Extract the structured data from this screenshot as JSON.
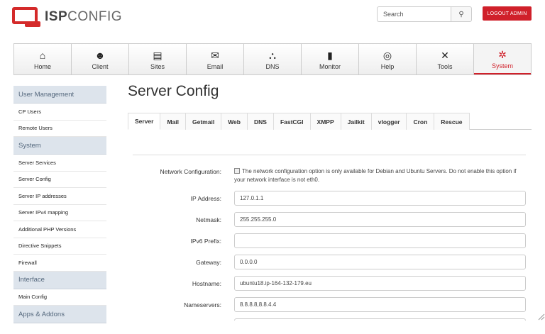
{
  "header": {
    "logo_isp": "ISP",
    "logo_config": "CONFIG",
    "search_placeholder": "Search",
    "search_icon": "search-icon",
    "logout_label": "LOGOUT ADMIN"
  },
  "nav": [
    {
      "label": "Home",
      "icon": "home-icon",
      "glyph": "⌂"
    },
    {
      "label": "Client",
      "icon": "users-icon",
      "glyph": "👥"
    },
    {
      "label": "Sites",
      "icon": "sites-icon",
      "glyph": "▤"
    },
    {
      "label": "Email",
      "icon": "email-icon",
      "glyph": "✉"
    },
    {
      "label": "DNS",
      "icon": "dns-icon",
      "glyph": "⛬"
    },
    {
      "label": "Monitor",
      "icon": "monitor-icon",
      "glyph": "▮"
    },
    {
      "label": "Help",
      "icon": "help-icon",
      "glyph": "◎"
    },
    {
      "label": "Tools",
      "icon": "tools-icon",
      "glyph": "✕"
    },
    {
      "label": "System",
      "icon": "gear-icon",
      "glyph": "✲"
    }
  ],
  "sidebar": {
    "user_management": "User Management",
    "cp_users": "CP Users",
    "remote_users": "Remote Users",
    "system": "System",
    "server_services": "Server Services",
    "server_config": "Server Config",
    "server_ip": "Server IP addresses",
    "server_ipv4": "Server IPv4 mapping",
    "additional_php": "Additional PHP Versions",
    "directive_snippets": "Directive Snippets",
    "firewall": "Firewall",
    "interface": "Interface",
    "main_config": "Main Config",
    "apps_addons": "Apps & Addons"
  },
  "main": {
    "title": "Server Config",
    "tabs": [
      "Server",
      "Mail",
      "Getmail",
      "Web",
      "DNS",
      "FastCGI",
      "XMPP",
      "Jailkit",
      "vlogger",
      "Cron",
      "Rescue"
    ],
    "active_tab": "Server"
  },
  "form": {
    "network_label": "Network Configuration:",
    "network_text": "The network configuration option is only available for Debian and Ubuntu Servers. Do not enable this option if your network interface is not eth0.",
    "ip_label": "IP Address:",
    "ip_value": "127.0.1.1",
    "netmask_label": "Netmask:",
    "netmask_value": "255.255.255.0",
    "ipv6_label": "IPv6 Prefix:",
    "ipv6_value": "",
    "gateway_label": "Gateway:",
    "gateway_value": "0.0.0.0",
    "hostname_label": "Hostname:",
    "hostname_value": "ubuntu18.ip-164-132-179.eu",
    "nameservers_label": "Nameservers:",
    "nameservers_value": "8.8.8.8,8.8.4.4"
  },
  "colors": {
    "accent": "#d0202a",
    "sidebar_header": "#dde4ec"
  }
}
